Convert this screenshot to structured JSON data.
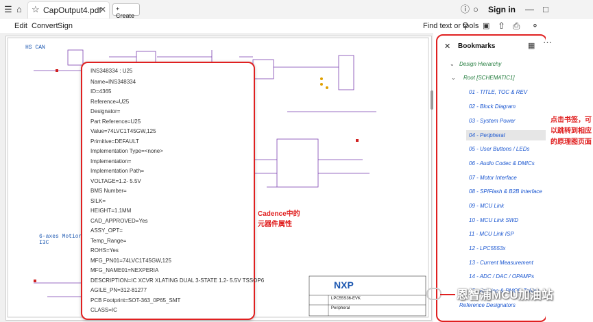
{
  "tab": {
    "title": "CapOutput4.pdf"
  },
  "toolbar": {
    "create_label": "+ Create",
    "signin_label": "Sign in",
    "find_label": "Find text or tools"
  },
  "menu": [
    "Edit",
    "Convert",
    "Sign"
  ],
  "schematic": {
    "title_hs_can": "HS CAN",
    "label_motion": "6-axes Motion",
    "label_i3c": "I3C"
  },
  "properties": [
    "INS348334 : U25",
    "Name=INS348334",
    "ID=4365",
    "Reference=U25",
    "Designator=",
    "Part Reference=U25",
    "Value=74LVC1T45GW,125",
    "Primitive=DEFAULT",
    "Implementation Type=<none>",
    "Implementation=",
    "Implementation Path=",
    "VOLTAGE=1.2- 5.5V",
    "BMS Number=",
    "SILK=",
    "HEIGHT=1.1MM",
    "CAD_APPROVED=Yes",
    "ASSY_OPT=",
    "Temp_Range=",
    "ROHS=Yes",
    "MFG_PN01=74LVC1T45GW,125",
    "MFG_NAME01=NEXPERIA",
    "DESCRIPTION=IC XCVR XLATING DUAL 3-STATE 1.2- 5.5V TSSOP6",
    "AGILE_PN=312-81277",
    "PCB Footprint=SOT-363_0P65_SMT",
    "CLASS=IC"
  ],
  "annotation_props": "Cadence中的元器件属性",
  "annotation_bookmarks": "点击书签，可以跳转到相应的原理图页面",
  "bookmarks": {
    "title": "Bookmarks",
    "design_hierarchy": "Design Hierarchy",
    "root": "Root [SCHEMATIC1]",
    "items": [
      "01 - TITLE, TOC & REV",
      "02 - Block Diagram",
      "03 - System Power",
      "04 - Peripheral",
      "05 - User Buttons / LEDs",
      "06 - Audio Codec & DMICs",
      "07 - Motor Interface",
      "08 - SPIFlash & B2B Interface",
      "09 - MCU Link",
      "10 - MCU Link SWD",
      "11 - MCU Link ISP",
      "12 - LPC5553x",
      "13 - Current Measurement",
      "14 - ADC / DAC / OPAMPs",
      "15 - Arduino & PMOD Tables"
    ],
    "selected_index": 3,
    "reference_designators": "Reference Designators"
  },
  "titleblock": {
    "logo": "NXP",
    "board": "LPC55S36-EVK",
    "sheet": "Peripheral"
  },
  "watermark": "恩智浦MCU加油站",
  "colors": {
    "accent_red": "#e02020",
    "link_blue": "#1a56d0",
    "tree_green": "#1f7a3a"
  }
}
